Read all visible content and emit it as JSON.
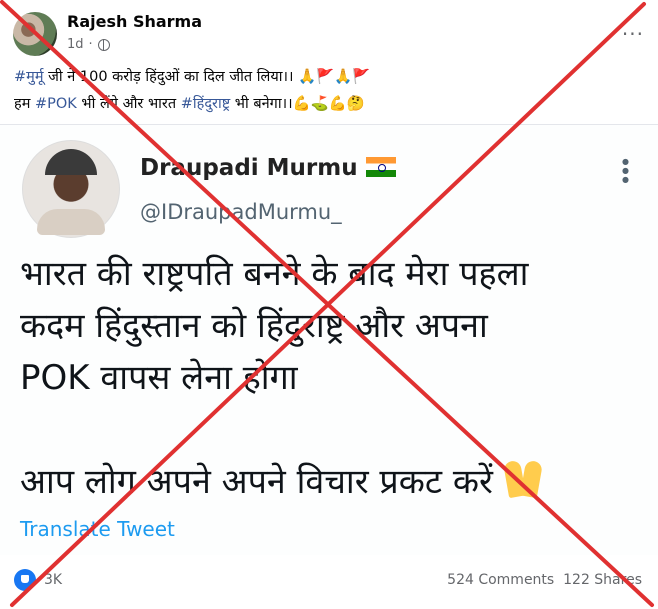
{
  "post": {
    "author": "Rajesh Sharma",
    "time": "1d",
    "more": "···",
    "caption_line1": {
      "tag": "#मुर्मू",
      "text": " जी ने 100 करोड़ हिंदुओं का दिल जीत लिया।। 🙏🚩🙏🚩"
    },
    "caption_line2": {
      "pre": "हम ",
      "tag1": "#POK",
      "mid": " भी लेंगे और भारत ",
      "tag2": "#हिंदुराष्ट्र",
      "post": " भी बनेगा।।💪⛳💪🤔"
    }
  },
  "tweet": {
    "name": "Draupadi Murmu",
    "handle": "@IDraupadMurmu_",
    "more": "⋮",
    "lines": [
      "भारत की राष्ट्रपति बनने के बाद मेरा पहला",
      "कदम हिंदुस्तान को हिंदुराष्ट्र और अपना",
      "POK वापस लेना होगा",
      "",
      "आप लोग अपने अपने विचार प्रकट करें"
    ],
    "translate": "Translate Tweet"
  },
  "footer": {
    "reactions": "3K",
    "comments": "524 Comments",
    "shares": "122 Shares"
  },
  "overlay": {
    "cross_color": "#e03131"
  }
}
